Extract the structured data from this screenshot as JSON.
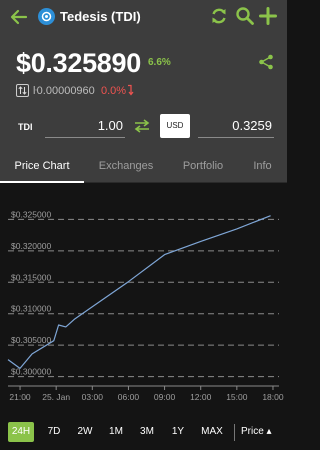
{
  "app_bar": {
    "title": "Tedesis (TDI)",
    "accent": "#8bc34a",
    "icons": [
      "arrow-left-icon",
      "coin-logo-icon",
      "refresh-icon",
      "search-icon",
      "plus-icon"
    ]
  },
  "header": {
    "price": "$0.325890",
    "change_pct": "6.6%",
    "btc_price": "ŀ0.00000960",
    "btc_change": "0.0%",
    "positive_color": "#8bc34a",
    "negative_color": "#ef5350"
  },
  "converter": {
    "from_label": "TDI",
    "from_value": "1.00",
    "to_label": "USD",
    "to_value": "0.3259"
  },
  "tabs": [
    {
      "label": "Price Chart",
      "active": true
    },
    {
      "label": "Exchanges",
      "active": false
    },
    {
      "label": "Portfolio",
      "active": false
    },
    {
      "label": "Info",
      "active": false
    }
  ],
  "range_buttons": [
    {
      "label": "24H",
      "active": true
    },
    {
      "label": "7D",
      "active": false
    },
    {
      "label": "2W",
      "active": false
    },
    {
      "label": "1M",
      "active": false
    },
    {
      "label": "3M",
      "active": false
    },
    {
      "label": "1Y",
      "active": false
    },
    {
      "label": "MAX",
      "active": false
    }
  ],
  "metric_selector": "Price ▴",
  "chart_data": {
    "type": "line",
    "title": "",
    "xlabel": "",
    "ylabel": "",
    "y_ticks": [
      "$0.325000",
      "$0.320000",
      "$0.315000",
      "$0.310000",
      "$0.305000",
      "$0.300000"
    ],
    "y_tick_values": [
      0.325,
      0.32,
      0.315,
      0.31,
      0.305,
      0.3
    ],
    "x_ticks": [
      "21:00",
      "25. Jan",
      "03:00",
      "06:00",
      "09:00",
      "12:00",
      "15:00",
      "18:00"
    ],
    "x_tick_values": [
      0,
      3,
      6,
      9,
      12,
      15,
      18,
      21
    ],
    "ylim": [
      0.2985,
      0.3265
    ],
    "xlim": [
      -1,
      21.5
    ],
    "grid": true,
    "series": [
      {
        "color": "#7fa6d6",
        "x": [
          -1,
          0,
          1,
          2.8,
          3.2,
          3.8,
          4.5,
          6,
          9,
          12,
          15,
          18,
          20.8
        ],
        "y": [
          0.3027,
          0.3013,
          0.3036,
          0.3057,
          0.3082,
          0.3079,
          0.3091,
          0.3111,
          0.3151,
          0.3194,
          0.3215,
          0.3235,
          0.3256
        ]
      }
    ]
  }
}
